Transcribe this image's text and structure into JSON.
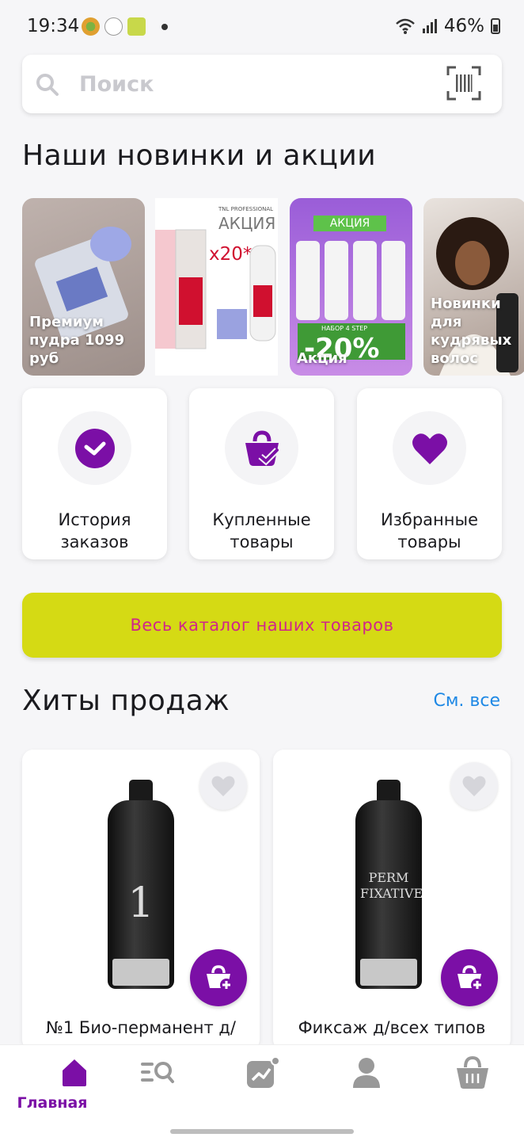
{
  "status_bar": {
    "time": "19:34",
    "battery": "46%"
  },
  "search": {
    "placeholder": "Поиск"
  },
  "promos_section": {
    "title": "Наши новинки и акции",
    "cards": [
      {
        "label": "Премиум пудра 1099 руб",
        "print": ""
      },
      {
        "label": "",
        "print_brand": "TNL PROFESSIONAL",
        "print_title": "АКЦИЯ",
        "print_multiplier": "х20*"
      },
      {
        "label": "Акция",
        "print_badge": "АКЦИЯ",
        "print_sub": "НАБОР 4 STEP",
        "print_discount": "-20%"
      },
      {
        "label": "Новинки для кудрявых волос"
      }
    ]
  },
  "quick_actions": [
    {
      "label": "История заказов",
      "icon": "check-circle-icon"
    },
    {
      "label": "Купленные товары",
      "icon": "basket-check-icon"
    },
    {
      "label": "Избранные товары",
      "icon": "heart-icon"
    }
  ],
  "catalog_button": {
    "label": "Весь каталог наших товаров"
  },
  "bestsellers": {
    "title": "Хиты продаж",
    "see_all": "См. все",
    "products": [
      {
        "name": "№1 Био-перманент д/",
        "bottle_text": "1"
      },
      {
        "name": "Фиксаж д/всех типов",
        "bottle_text": "PERM FIXATIVE"
      }
    ]
  },
  "bottom_nav": {
    "items": [
      {
        "label": "Главная",
        "icon": "home-icon",
        "active": true
      },
      {
        "label": "",
        "icon": "catalog-search-icon"
      },
      {
        "label": "",
        "icon": "trending-icon"
      },
      {
        "label": "",
        "icon": "profile-icon"
      },
      {
        "label": "",
        "icon": "cart-icon"
      }
    ]
  },
  "colors": {
    "accent_purple": "#7b0fa6",
    "catalog_yellow": "#d5da14",
    "catalog_text": "#d0258a",
    "link_blue": "#1e88e5"
  }
}
